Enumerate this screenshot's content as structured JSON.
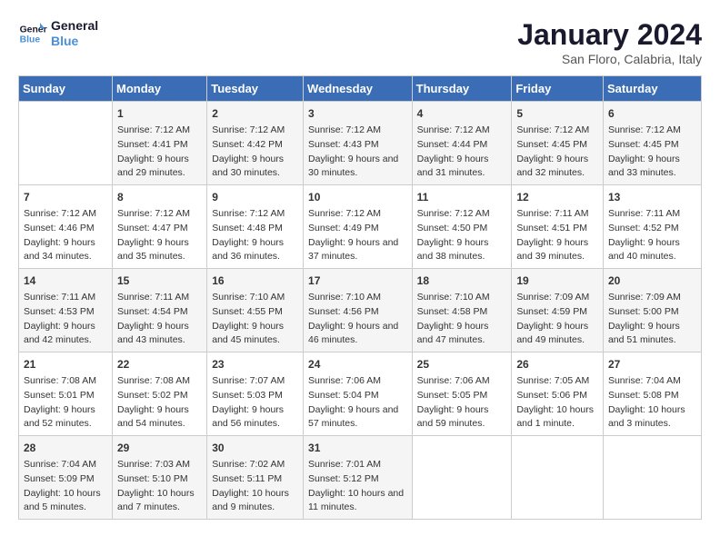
{
  "header": {
    "logo_line1": "General",
    "logo_line2": "Blue",
    "month_title": "January 2024",
    "location": "San Floro, Calabria, Italy"
  },
  "days_of_week": [
    "Sunday",
    "Monday",
    "Tuesday",
    "Wednesday",
    "Thursday",
    "Friday",
    "Saturday"
  ],
  "weeks": [
    [
      {
        "day": "",
        "content": ""
      },
      {
        "day": "1",
        "sunrise": "Sunrise: 7:12 AM",
        "sunset": "Sunset: 4:41 PM",
        "daylight": "Daylight: 9 hours and 29 minutes."
      },
      {
        "day": "2",
        "sunrise": "Sunrise: 7:12 AM",
        "sunset": "Sunset: 4:42 PM",
        "daylight": "Daylight: 9 hours and 30 minutes."
      },
      {
        "day": "3",
        "sunrise": "Sunrise: 7:12 AM",
        "sunset": "Sunset: 4:43 PM",
        "daylight": "Daylight: 9 hours and 30 minutes."
      },
      {
        "day": "4",
        "sunrise": "Sunrise: 7:12 AM",
        "sunset": "Sunset: 4:44 PM",
        "daylight": "Daylight: 9 hours and 31 minutes."
      },
      {
        "day": "5",
        "sunrise": "Sunrise: 7:12 AM",
        "sunset": "Sunset: 4:45 PM",
        "daylight": "Daylight: 9 hours and 32 minutes."
      },
      {
        "day": "6",
        "sunrise": "Sunrise: 7:12 AM",
        "sunset": "Sunset: 4:45 PM",
        "daylight": "Daylight: 9 hours and 33 minutes."
      }
    ],
    [
      {
        "day": "7",
        "sunrise": "Sunrise: 7:12 AM",
        "sunset": "Sunset: 4:46 PM",
        "daylight": "Daylight: 9 hours and 34 minutes."
      },
      {
        "day": "8",
        "sunrise": "Sunrise: 7:12 AM",
        "sunset": "Sunset: 4:47 PM",
        "daylight": "Daylight: 9 hours and 35 minutes."
      },
      {
        "day": "9",
        "sunrise": "Sunrise: 7:12 AM",
        "sunset": "Sunset: 4:48 PM",
        "daylight": "Daylight: 9 hours and 36 minutes."
      },
      {
        "day": "10",
        "sunrise": "Sunrise: 7:12 AM",
        "sunset": "Sunset: 4:49 PM",
        "daylight": "Daylight: 9 hours and 37 minutes."
      },
      {
        "day": "11",
        "sunrise": "Sunrise: 7:12 AM",
        "sunset": "Sunset: 4:50 PM",
        "daylight": "Daylight: 9 hours and 38 minutes."
      },
      {
        "day": "12",
        "sunrise": "Sunrise: 7:11 AM",
        "sunset": "Sunset: 4:51 PM",
        "daylight": "Daylight: 9 hours and 39 minutes."
      },
      {
        "day": "13",
        "sunrise": "Sunrise: 7:11 AM",
        "sunset": "Sunset: 4:52 PM",
        "daylight": "Daylight: 9 hours and 40 minutes."
      }
    ],
    [
      {
        "day": "14",
        "sunrise": "Sunrise: 7:11 AM",
        "sunset": "Sunset: 4:53 PM",
        "daylight": "Daylight: 9 hours and 42 minutes."
      },
      {
        "day": "15",
        "sunrise": "Sunrise: 7:11 AM",
        "sunset": "Sunset: 4:54 PM",
        "daylight": "Daylight: 9 hours and 43 minutes."
      },
      {
        "day": "16",
        "sunrise": "Sunrise: 7:10 AM",
        "sunset": "Sunset: 4:55 PM",
        "daylight": "Daylight: 9 hours and 45 minutes."
      },
      {
        "day": "17",
        "sunrise": "Sunrise: 7:10 AM",
        "sunset": "Sunset: 4:56 PM",
        "daylight": "Daylight: 9 hours and 46 minutes."
      },
      {
        "day": "18",
        "sunrise": "Sunrise: 7:10 AM",
        "sunset": "Sunset: 4:58 PM",
        "daylight": "Daylight: 9 hours and 47 minutes."
      },
      {
        "day": "19",
        "sunrise": "Sunrise: 7:09 AM",
        "sunset": "Sunset: 4:59 PM",
        "daylight": "Daylight: 9 hours and 49 minutes."
      },
      {
        "day": "20",
        "sunrise": "Sunrise: 7:09 AM",
        "sunset": "Sunset: 5:00 PM",
        "daylight": "Daylight: 9 hours and 51 minutes."
      }
    ],
    [
      {
        "day": "21",
        "sunrise": "Sunrise: 7:08 AM",
        "sunset": "Sunset: 5:01 PM",
        "daylight": "Daylight: 9 hours and 52 minutes."
      },
      {
        "day": "22",
        "sunrise": "Sunrise: 7:08 AM",
        "sunset": "Sunset: 5:02 PM",
        "daylight": "Daylight: 9 hours and 54 minutes."
      },
      {
        "day": "23",
        "sunrise": "Sunrise: 7:07 AM",
        "sunset": "Sunset: 5:03 PM",
        "daylight": "Daylight: 9 hours and 56 minutes."
      },
      {
        "day": "24",
        "sunrise": "Sunrise: 7:06 AM",
        "sunset": "Sunset: 5:04 PM",
        "daylight": "Daylight: 9 hours and 57 minutes."
      },
      {
        "day": "25",
        "sunrise": "Sunrise: 7:06 AM",
        "sunset": "Sunset: 5:05 PM",
        "daylight": "Daylight: 9 hours and 59 minutes."
      },
      {
        "day": "26",
        "sunrise": "Sunrise: 7:05 AM",
        "sunset": "Sunset: 5:06 PM",
        "daylight": "Daylight: 10 hours and 1 minute."
      },
      {
        "day": "27",
        "sunrise": "Sunrise: 7:04 AM",
        "sunset": "Sunset: 5:08 PM",
        "daylight": "Daylight: 10 hours and 3 minutes."
      }
    ],
    [
      {
        "day": "28",
        "sunrise": "Sunrise: 7:04 AM",
        "sunset": "Sunset: 5:09 PM",
        "daylight": "Daylight: 10 hours and 5 minutes."
      },
      {
        "day": "29",
        "sunrise": "Sunrise: 7:03 AM",
        "sunset": "Sunset: 5:10 PM",
        "daylight": "Daylight: 10 hours and 7 minutes."
      },
      {
        "day": "30",
        "sunrise": "Sunrise: 7:02 AM",
        "sunset": "Sunset: 5:11 PM",
        "daylight": "Daylight: 10 hours and 9 minutes."
      },
      {
        "day": "31",
        "sunrise": "Sunrise: 7:01 AM",
        "sunset": "Sunset: 5:12 PM",
        "daylight": "Daylight: 10 hours and 11 minutes."
      },
      {
        "day": "",
        "content": ""
      },
      {
        "day": "",
        "content": ""
      },
      {
        "day": "",
        "content": ""
      }
    ]
  ]
}
